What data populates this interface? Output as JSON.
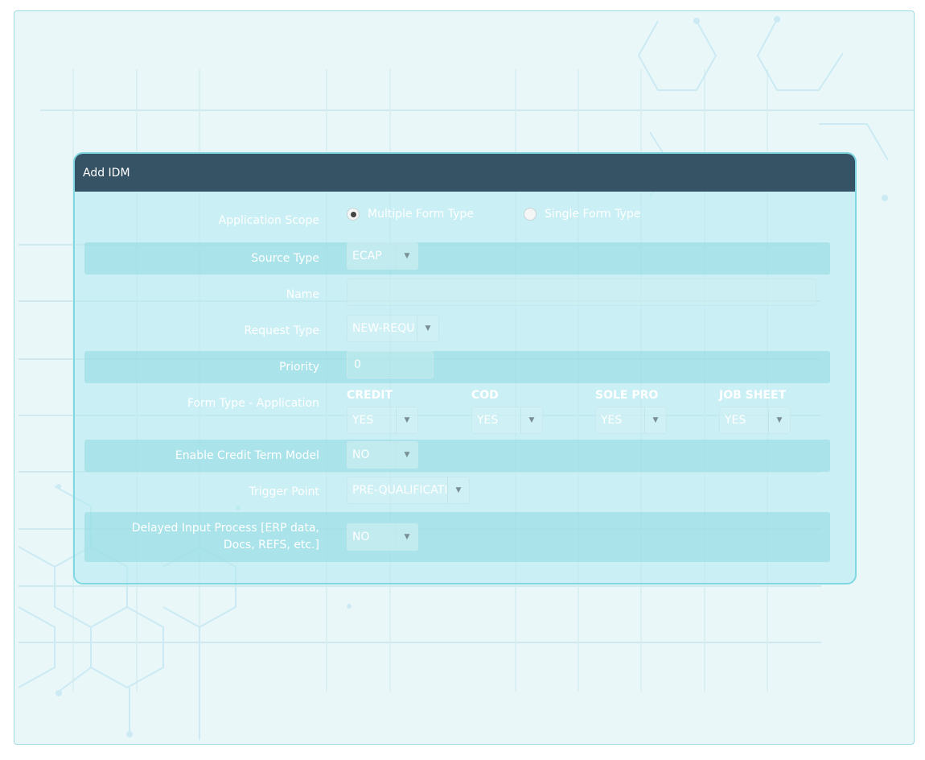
{
  "dialog": {
    "title": "Add IDM"
  },
  "fields": {
    "application_scope": {
      "label": "Application Scope",
      "options": [
        {
          "label": "Multiple Form Type",
          "checked": true
        },
        {
          "label": "Single Form Type",
          "checked": false
        }
      ]
    },
    "source_type": {
      "label": "Source Type",
      "value": "ECAP"
    },
    "name": {
      "label": "Name",
      "value": ""
    },
    "request_type": {
      "label": "Request Type",
      "value": "NEW-REQU"
    },
    "priority": {
      "label": "Priority",
      "value": "0"
    },
    "form_type": {
      "label": "Form Type - Application",
      "columns": [
        {
          "header": "CREDIT",
          "value": "YES"
        },
        {
          "header": "COD",
          "value": "YES"
        },
        {
          "header": "SOLE PRO",
          "value": "YES"
        },
        {
          "header": "JOB SHEET",
          "value": "YES"
        }
      ]
    },
    "enable_credit_term_model": {
      "label": "Enable Credit Term Model",
      "value": "NO"
    },
    "trigger_point": {
      "label": "Trigger Point",
      "value": "PRE-QUALIFICATI"
    },
    "delayed_input_process": {
      "label_line1": "Delayed Input Process [ERP data,",
      "label_line2": "Docs, REFS, etc.]",
      "value": "NO"
    }
  },
  "icons": {
    "caret": "caret-down-icon",
    "radio": "radio-icon"
  },
  "colors": {
    "header_bg": "#355365",
    "panel_bg": "#b7eaf0",
    "stripe_bg": "#8fd8e0",
    "frame_border": "#9edbe2",
    "page_bg": "#eaf7f9"
  }
}
